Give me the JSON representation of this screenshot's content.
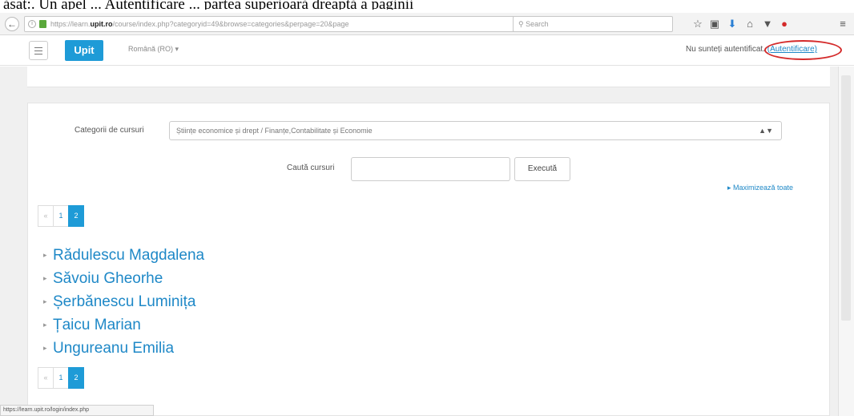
{
  "caption": "ăsaț:. Un apel ... Autentificare ... partea superioară dreaptă a paginii",
  "browser": {
    "url_prefix": "https://learn.",
    "url_domain": "upit.ro",
    "url_rest": "/course/index.php?categoryid=49&browse=categories&perpage=20&page",
    "search_placeholder": "Search",
    "status_url": "https://learn.upit.ro/login/index.php"
  },
  "header": {
    "logo": "Upit",
    "language": "Română (RO) ▾",
    "login_text": "Nu sunteți autentificat.",
    "login_link": "(Autentificare)"
  },
  "filters": {
    "category_label": "Categorii de cursuri",
    "category_value": "Științe economice și drept / Finanțe,Contabilitate și Economie",
    "search_label": "Caută cursuri",
    "run_button": "Execută",
    "expand_all": "▸ Maximizează toate"
  },
  "pagination": {
    "prev": "«",
    "pages": [
      "1",
      "2"
    ],
    "active": "2"
  },
  "teachers": [
    "Rădulescu Magdalena",
    "Săvoiu Gheorhe",
    "Șerbănescu Luminița",
    "Țaicu Marian",
    "Ungureanu Emilia"
  ]
}
